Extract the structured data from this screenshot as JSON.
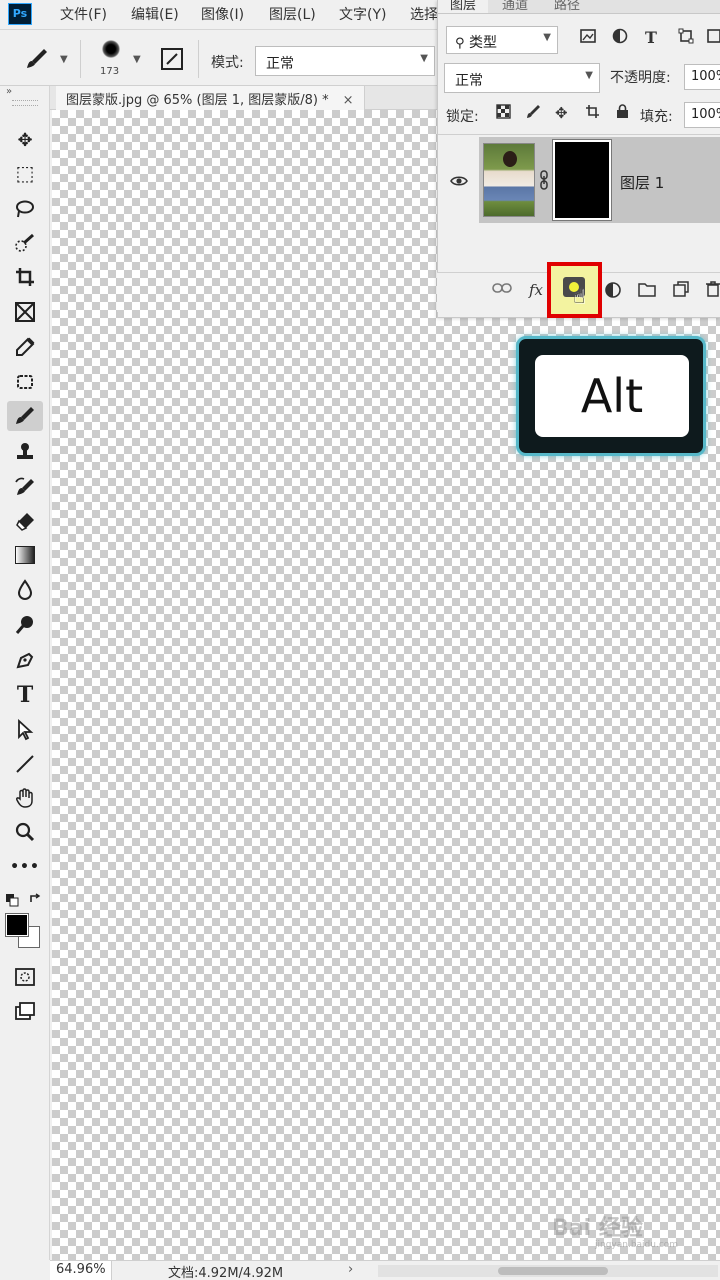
{
  "app": {
    "logo": "Ps"
  },
  "menu": [
    "文件(F)",
    "编辑(E)",
    "图像(I)",
    "图层(L)",
    "文字(Y)",
    "选择"
  ],
  "options_bar": {
    "brush_size": "173",
    "mode_label": "模式:",
    "mode_value": "正常"
  },
  "document": {
    "tab_title": "图层蒙版.jpg @ 65% (图层 1, 图层蒙版/8) *",
    "close": "×"
  },
  "tools": [
    {
      "name": "move-tool",
      "icon": "✥"
    },
    {
      "name": "marquee-tool",
      "icon": "⬚"
    },
    {
      "name": "lasso-tool",
      "icon": "ℓ"
    },
    {
      "name": "quick-select-tool",
      "icon": "✎"
    },
    {
      "name": "crop-tool",
      "icon": "⌗"
    },
    {
      "name": "frame-tool",
      "icon": "⊠"
    },
    {
      "name": "eyedropper-tool",
      "icon": "✐"
    },
    {
      "name": "healing-tool",
      "icon": "▣"
    },
    {
      "name": "brush-tool",
      "icon": "🖌"
    },
    {
      "name": "stamp-tool",
      "icon": "⏚"
    },
    {
      "name": "history-brush-tool",
      "icon": "↶"
    },
    {
      "name": "eraser-tool",
      "icon": "⌫"
    },
    {
      "name": "gradient-tool",
      "icon": "▤"
    },
    {
      "name": "blur-tool",
      "icon": "◌"
    },
    {
      "name": "dodge-tool",
      "icon": "●"
    },
    {
      "name": "pen-tool",
      "icon": "✒"
    },
    {
      "name": "type-tool",
      "icon": "T"
    },
    {
      "name": "path-select-tool",
      "icon": "➤"
    },
    {
      "name": "line-tool",
      "icon": "╱"
    },
    {
      "name": "hand-tool",
      "icon": "✋"
    },
    {
      "name": "zoom-tool",
      "icon": "⚲"
    },
    {
      "name": "more-tools",
      "icon": "•••"
    }
  ],
  "colors": {
    "foreground": "#000000",
    "background": "#ffffff",
    "highlight": "#e00000",
    "alt_border": "#56b8c9"
  },
  "layers_panel": {
    "tabs": [
      "图层",
      "通道",
      "路径"
    ],
    "filter_value": "类型",
    "blend_mode": "正常",
    "opacity_label": "不透明度:",
    "opacity_value": "100%",
    "lock_label": "锁定:",
    "fill_label": "填充:",
    "fill_value": "100%",
    "layer_name": "图层 1",
    "bottom_icons": [
      "link-icon",
      "fx-icon",
      "add-mask-icon",
      "adjustment-icon",
      "folder-icon",
      "new-layer-icon",
      "trash-icon"
    ],
    "fx_text": "fx"
  },
  "overlay": {
    "key_label": "Alt"
  },
  "status_bar": {
    "zoom": "64.96%",
    "doc_size": "文档:4.92M/4.92M",
    "arrow": "›"
  },
  "watermark": {
    "text": "Bai 经验",
    "sub": "jingyan.baidu.com"
  }
}
